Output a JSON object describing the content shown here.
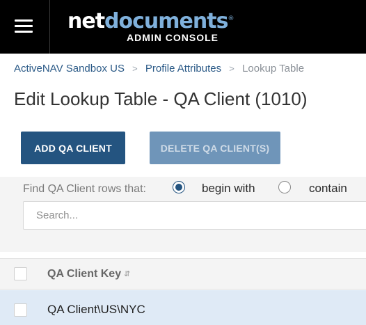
{
  "header": {
    "logo_net": "net",
    "logo_documents": "documents",
    "logo_mark": "®",
    "subtitle": "ADMIN CONSOLE"
  },
  "breadcrumb": {
    "items": [
      "ActiveNAV Sandbox US",
      "Profile Attributes"
    ],
    "current": "Lookup Table",
    "separator": ">"
  },
  "page": {
    "title": "Edit Lookup Table - QA Client (1010)"
  },
  "actions": {
    "add_label": "ADD QA CLIENT",
    "delete_label": "DELETE QA CLIENT(S)"
  },
  "filter": {
    "find_label": "Find QA Client rows that:",
    "options": [
      "begin with",
      "contain"
    ],
    "selected": "begin with",
    "search_placeholder": "Search...",
    "search_value": ""
  },
  "table": {
    "columns": [
      "QA Client Key"
    ],
    "rows": [
      {
        "key": "QA Client\\US\\NYC"
      }
    ]
  },
  "colors": {
    "header_bg": "#000000",
    "brand_accent": "#7fb0db",
    "primary_button": "#245480",
    "disabled_button": "#6f95b9",
    "link": "#2b5a87",
    "selected_row": "#dfeaf6"
  },
  "icons": {
    "menu": "hamburger-menu-icon",
    "sort": "sort-arrows-icon"
  }
}
